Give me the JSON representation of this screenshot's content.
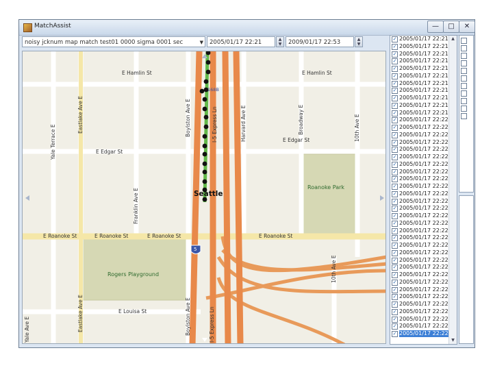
{
  "window": {
    "title": "MatchAssist"
  },
  "toolbar": {
    "query": "noisy jcknum map match test01 0000 sigma 0001 sec",
    "start_time": "2005/01/17 22:21",
    "end_time": "2009/01/17 22:53"
  },
  "map": {
    "streets": {
      "hamlin_w": "E Hamlin St",
      "hamlin_e": "E Hamlin St",
      "edgar_w": "E Edgar St",
      "edgar_e": "E Edgar St",
      "roanoke_w": "E Roanoke St",
      "roanoke_m": "E Roanoke St",
      "roanoke_r": "E Roanoke St",
      "roanoke_e": "E Roanoke St",
      "louisa": "E Louisa St",
      "eastlake_n": "Eastlake Ave E",
      "eastlake_s": "Eastlake Ave E",
      "yale_terr": "Yale Terrace E",
      "yale": "Yale Ave E",
      "franklin": "Franklin Ave E",
      "boylston_n": "Boylston Ave E",
      "boylston_s": "Boylston Ave E",
      "express_n": "I-5 Express Ln",
      "express_s": "I-5 Express Ln",
      "harvard": "Harvard Ave E",
      "broadway": "Broadway E",
      "tenth_n": "10th Ave E",
      "tenth_s": "10th Ave E"
    },
    "parks": {
      "roanoke": "Roanoke Park",
      "rogers": "Rogers Playground"
    },
    "city": "Seattle",
    "shield": "5",
    "exit_label": "168B"
  },
  "list": {
    "rows": [
      "2005/01/17 22:21",
      "2005/01/17 22:21",
      "2005/01/17 22:21",
      "2005/01/17 22:21",
      "2005/01/17 22:21",
      "2005/01/17 22:21",
      "2005/01/17 22:21",
      "2005/01/17 22:21",
      "2005/01/17 22:21",
      "2005/01/17 22:21",
      "2005/01/17 22:21",
      "2005/01/17 22:22",
      "2005/01/17 22:22",
      "2005/01/17 22:22",
      "2005/01/17 22:22",
      "2005/01/17 22:22",
      "2005/01/17 22:22",
      "2005/01/17 22:22",
      "2005/01/17 22:22",
      "2005/01/17 22:22",
      "2005/01/17 22:22",
      "2005/01/17 22:22",
      "2005/01/17 22:22",
      "2005/01/17 22:22",
      "2005/01/17 22:22",
      "2005/01/17 22:22",
      "2005/01/17 22:22",
      "2005/01/17 22:22",
      "2005/01/17 22:22",
      "2005/01/17 22:22",
      "2005/01/17 22:22",
      "2005/01/17 22:22",
      "2005/01/17 22:22",
      "2005/01/17 22:22",
      "2005/01/17 22:22",
      "2005/01/17 22:22",
      "2005/01/17 22:22",
      "2005/01/17 22:22",
      "2005/01/17 22:22",
      "2005/01/17 22:22",
      "2005/01/17 22:22"
    ],
    "selected_index": 40
  }
}
